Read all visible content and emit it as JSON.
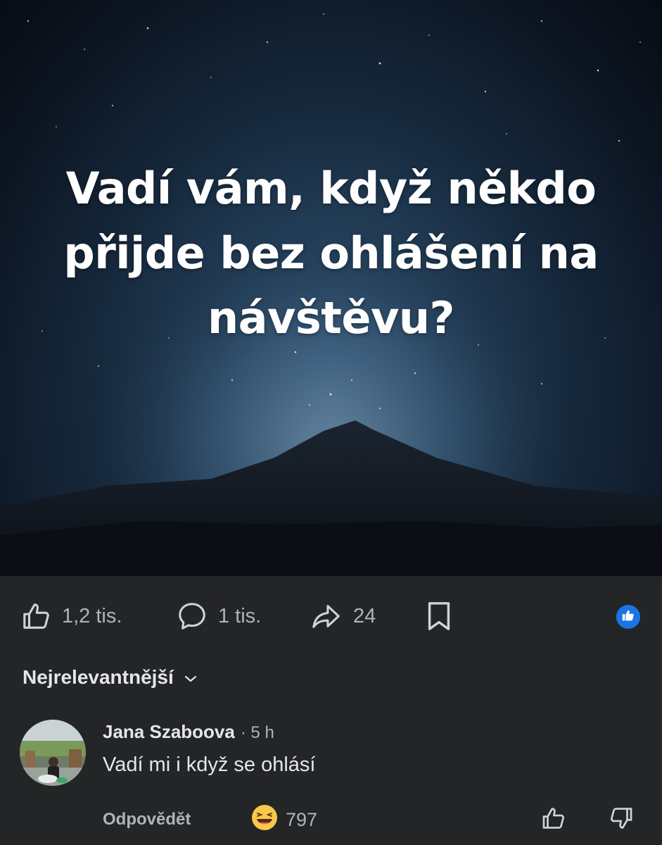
{
  "post": {
    "headline": "Vadí vám, když někdo přijde bez ohlášení na návštěvu?"
  },
  "actions": {
    "likes": "1,2 tis.",
    "comments": "1 tis.",
    "shares": "24"
  },
  "sort": {
    "label": "Nejrelevantnější",
    "icon": "chevron-down-icon"
  },
  "comment": {
    "author": "Jana Szaboova",
    "time": "· 5 h",
    "text": "Vadí mi i když se ohlásí",
    "reply_label": "Odpovědět",
    "reaction_emoji": "😆",
    "reaction_count": "797"
  },
  "colors": {
    "background": "#242526",
    "text_primary": "#e4e6eb",
    "text_secondary": "#b0b3b8",
    "like_blue": "#1b74e4"
  }
}
